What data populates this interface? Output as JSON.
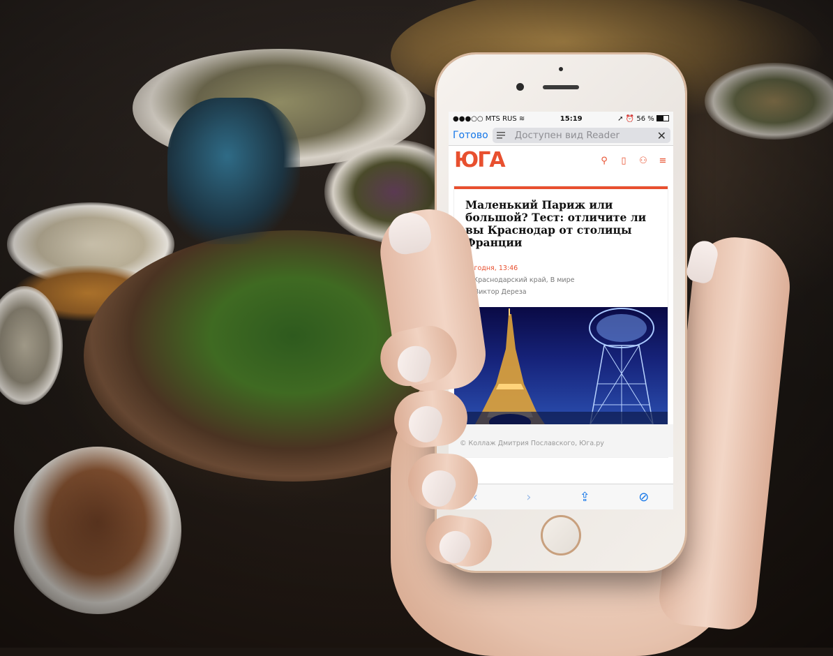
{
  "status": {
    "carrier": "●●●○○ MTS RUS",
    "wifi": "wifi-icon",
    "time": "15:19",
    "location": "location-arrow-icon",
    "alarm": "alarm-icon",
    "battery": "56 %"
  },
  "browser": {
    "done_label": "Готово",
    "reader_text": "Доступен вид Reader",
    "reader_icon": "reader-lines-icon",
    "close_icon": "close-icon"
  },
  "site": {
    "logo": "ЮГА",
    "accent": "#e8502f",
    "icons": [
      "search-icon",
      "bookmark-icon",
      "user-icon",
      "menu-icon"
    ]
  },
  "article": {
    "title": "Маленький Париж или большой? Тест: отличите ли вы Краснодар от столицы Франции",
    "date": "Сегодня, 13:46",
    "location": "Краснодарский край, В мире",
    "author": "Виктор Дереза",
    "caption": "© Коллаж Дмитрия Пославского, Юга.ру"
  },
  "toolbar": {
    "back": "‹",
    "forward": "›",
    "share_icon": "share-icon",
    "compass_icon": "compass-icon"
  }
}
